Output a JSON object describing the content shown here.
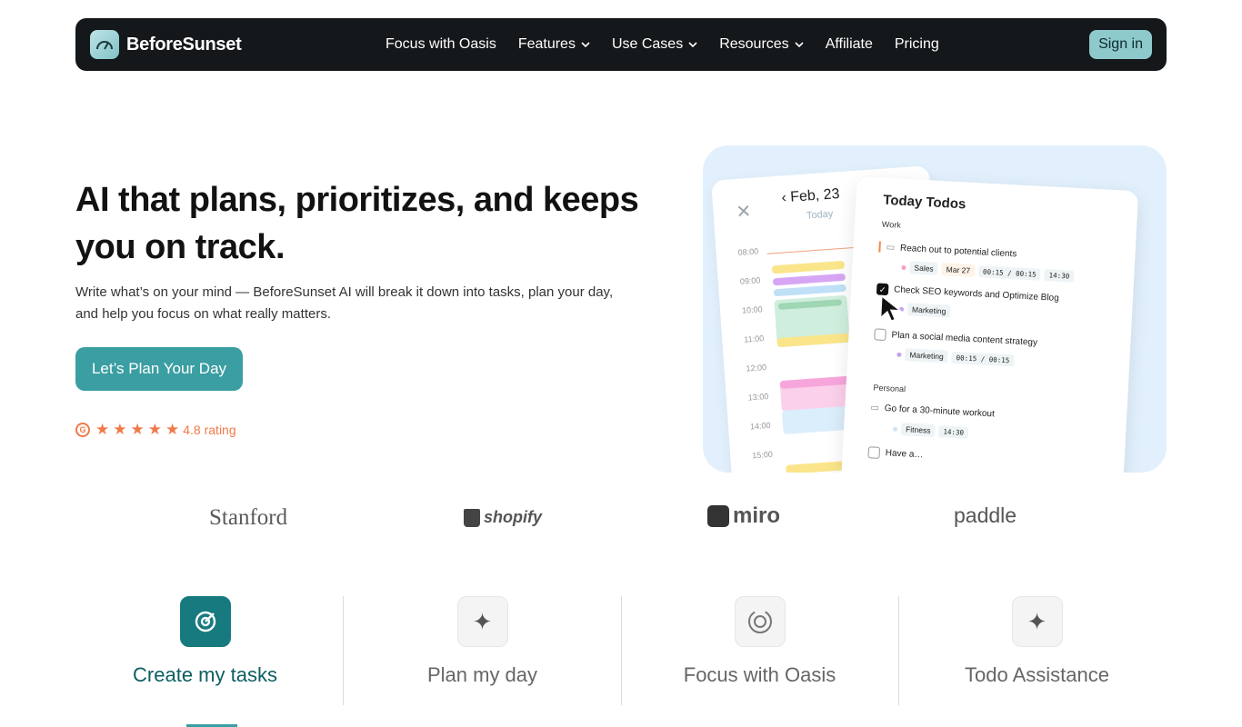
{
  "nav": {
    "brand": "BeforeSunset",
    "items": [
      {
        "label": "Focus with Oasis",
        "dropdown": false
      },
      {
        "label": "Features",
        "dropdown": true
      },
      {
        "label": "Use Cases",
        "dropdown": true
      },
      {
        "label": "Resources",
        "dropdown": true
      },
      {
        "label": "Affiliate",
        "dropdown": false
      },
      {
        "label": "Pricing",
        "dropdown": false
      }
    ],
    "signin": "Sign in"
  },
  "hero": {
    "title": "AI that plans, prioritizes, and keeps you on track.",
    "subtitle": "Write what’s on your mind — BeforeSunset AI will break it down into tasks, plan your day, and help you focus on what really matters.",
    "cta": "Let’s Plan Your Day",
    "rating_text": "4.8 rating",
    "rating_icon": "g2-icon",
    "stars": 5
  },
  "illustration": {
    "calendar": {
      "date": "Feb, 23",
      "today": "Today",
      "hours": [
        "08:00",
        "09:00",
        "10:00",
        "11:00",
        "12:00",
        "13:00",
        "14:00",
        "15:00"
      ]
    },
    "todos": {
      "title": "Today Todos",
      "sections": {
        "work": "Work",
        "personal": "Personal"
      },
      "items": [
        {
          "text": "Reach out to potential clients",
          "tag": "Sales",
          "date": "Mar 27",
          "timer": "00:15 / 00:15",
          "time": "14:30"
        },
        {
          "text": "Check SEO keywords and Optimize Blog",
          "tag": "Marketing"
        },
        {
          "text": "Plan a social media content strategy",
          "tag": "Marketing",
          "timer": "00:15 / 00:15"
        },
        {
          "text": "Go for a 30-minute workout",
          "tag": "Fitness",
          "time": "14:30"
        },
        {
          "text": "Have a…"
        }
      ]
    }
  },
  "logos": [
    "Stanford",
    "shopify",
    "miro",
    "paddle"
  ],
  "features": [
    {
      "label": "Create my tasks",
      "icon": "target-icon",
      "active": true
    },
    {
      "label": "Plan my day",
      "icon": "sparkle-icon",
      "active": false
    },
    {
      "label": "Focus with Oasis",
      "icon": "oasis-icon",
      "active": false
    },
    {
      "label": "Todo Assistance",
      "icon": "sparkle-icon",
      "active": false
    }
  ],
  "colors": {
    "nav_bg": "#14181a",
    "accent": "#3a9ea2",
    "active_feature": "#167a7f",
    "rating": "#f07a4a",
    "illustration_bg": "#e1f0fc"
  }
}
